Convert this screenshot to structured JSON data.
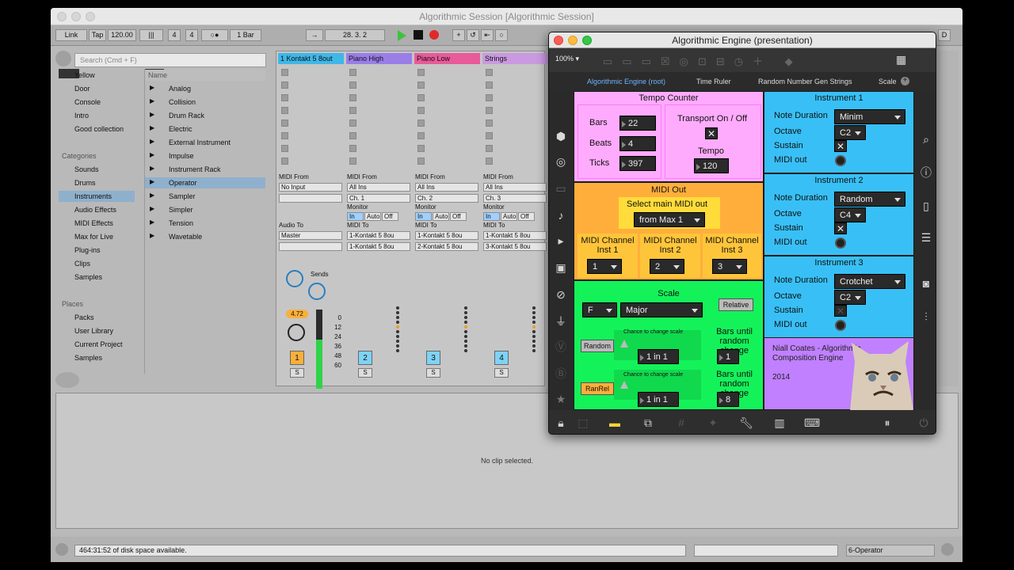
{
  "live": {
    "window_title": "Algorithmic Session  [Algorithmic Session]",
    "transport": {
      "link": "Link",
      "tap": "Tap",
      "tempo": "120.00",
      "sig_num": "4",
      "sig_den": "4",
      "quant": "1 Bar",
      "position": "28.  3.  2"
    },
    "search_placeholder": "Search (Cmd + F)",
    "collections": [
      "Yellow",
      "Door",
      "Console",
      "Intro",
      "Good collection"
    ],
    "collection_colors": [
      "#e8e34a",
      "#3bd6a0",
      "#5ac0e8",
      "#b07ee0",
      "#c0c0c0"
    ],
    "categories_header": "Categories",
    "categories": [
      "Sounds",
      "Drums",
      "Instruments",
      "Audio Effects",
      "MIDI Effects",
      "Max for Live",
      "Plug-ins",
      "Clips",
      "Samples"
    ],
    "places_header": "Places",
    "places": [
      "Packs",
      "User Library",
      "Current Project",
      "Samples"
    ],
    "name_header": "Name",
    "devices": [
      "Analog",
      "Collision",
      "Drum Rack",
      "Electric",
      "External Instrument",
      "Impulse",
      "Instrument Rack",
      "Operator",
      "Sampler",
      "Simpler",
      "Tension",
      "Wavetable"
    ],
    "tracks": [
      {
        "name": "1 Kontakt 5 8out",
        "color": "#3fb7e8",
        "midi_from": "No Input",
        "ch": "",
        "out": "Master",
        "num": "1"
      },
      {
        "name": "Piano High",
        "color": "#9a7ee8",
        "midi_from": "All Ins",
        "ch": "Ch. 1",
        "out": "1-Kontakt 5 8ou",
        "num": "2"
      },
      {
        "name": "Piano Low",
        "color": "#e85a9a",
        "midi_from": "All Ins",
        "ch": "Ch. 2",
        "out": "1-Kontakt 5 8ou",
        "num": "3"
      },
      {
        "name": "Strings",
        "color": "#c99ae0",
        "midi_from": "All Ins",
        "ch": "Ch. 3",
        "out": "1-Kontakt 5 8ou",
        "num": "4"
      }
    ],
    "out2": [
      "1-Kontakt 5 8ou",
      "2-Kontakt 5 8ou",
      "3-Kontakt 5 8ou"
    ],
    "labels": {
      "midi_from": "MIDI From",
      "monitor": "Monitor",
      "midi_to": "MIDI To",
      "audio_to": "Audio To",
      "sends": "Sends",
      "in": "In",
      "auto": "Auto",
      "off": "Off",
      "s": "S"
    },
    "volume": "4.72",
    "db_ticks": [
      "0",
      "12",
      "24",
      "36",
      "48",
      "60"
    ],
    "detail_text": "No clip selected.",
    "status_text": "464:31:52 of disk space available.",
    "status_right": "6-Operator"
  },
  "max": {
    "title": "Algorithmic Engine (presentation)",
    "zoom": "100%",
    "tabs": [
      "Algorithmic Engine (root)",
      "Time Ruler",
      "Random Number Gen Strings",
      "Scale"
    ],
    "tempo_counter": {
      "title": "Tempo Counter",
      "bars_label": "Bars",
      "bars": "22",
      "beats_label": "Beats",
      "beats": "4",
      "ticks_label": "Ticks",
      "ticks": "397",
      "transport_label": "Transport On / Off",
      "tempo_label": "Tempo",
      "tempo": "120"
    },
    "midi_out": {
      "title": "MIDI Out",
      "select_label": "Select main MIDI out",
      "device": "from Max 1",
      "ch1_label": "MIDI Channel Inst 1",
      "ch1": "1",
      "ch2_label": "MIDI Channel Inst 2",
      "ch2": "2",
      "ch3_label": "MIDI Channel Inst 3",
      "ch3": "3"
    },
    "scale": {
      "title": "Scale",
      "root": "F",
      "mode": "Major",
      "relative": "Relative",
      "chance_label": "Chance to change scale",
      "bars_label": "Bars until random change",
      "random": "Random",
      "ratio1": "1 in 1",
      "bars1": "1",
      "ranrel": "RanRel",
      "ratio2": "1 in 1",
      "bars2": "8"
    },
    "instruments": [
      {
        "title": "Instrument 1",
        "duration": "Minim",
        "octave": "C2"
      },
      {
        "title": "Instrument 2",
        "duration": "Random",
        "octave": "C4"
      },
      {
        "title": "Instrument 3",
        "duration": "Crotchet",
        "octave": "C2"
      }
    ],
    "inst_labels": {
      "duration": "Note Duration",
      "octave": "Octave",
      "sustain": "Sustain",
      "midi_out": "MIDI out"
    },
    "credit": {
      "name": "Niall Coates - Algorithmic Composition Engine",
      "year": "2014"
    },
    "colors": {
      "pink": "#ffabfd",
      "orange": "#ffae3c",
      "green": "#14f25a",
      "blue": "#38c0f6",
      "lilac": "#c080ff"
    }
  }
}
